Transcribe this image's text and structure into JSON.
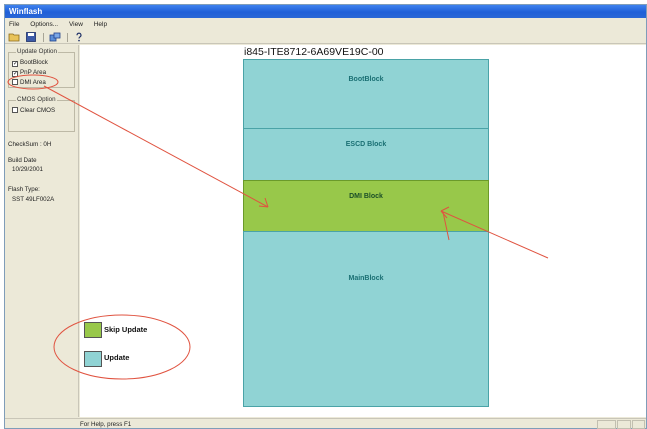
{
  "window": {
    "title": "Winflash"
  },
  "menu": [
    "File",
    "Options...",
    "View",
    "Help"
  ],
  "toolbar": [
    {
      "name": "open-icon",
      "glyph": "📂"
    },
    {
      "name": "save-icon",
      "glyph": "💾"
    },
    {
      "name": "flash-icon",
      "glyph": "⚙"
    },
    {
      "name": "help-icon",
      "glyph": "?"
    }
  ],
  "update_option": {
    "title": "Update Option",
    "items": [
      {
        "label": "BootBlock",
        "checked": true
      },
      {
        "label": "PnP Area",
        "checked": true
      },
      {
        "label": "DMI Area",
        "checked": false
      }
    ]
  },
  "cmos_option": {
    "title": "CMOS Option",
    "items": [
      {
        "label": "Clear CMOS",
        "checked": false
      }
    ]
  },
  "info": {
    "checksum": "CheckSum : 0H",
    "build_date_label": "Build Date",
    "build_date": "10/29/2001",
    "flash_type_label": "Flash Type:",
    "flash_type": "SST 49LF002A"
  },
  "chip": {
    "title": "i845-ITE8712-6A69VE19C-00",
    "blocks": [
      {
        "label": "BootBlock",
        "update": true
      },
      {
        "label": "ESCD Block",
        "update": true
      },
      {
        "label": "DMI Block",
        "update": false
      },
      {
        "label": "MainBlock",
        "update": true
      }
    ]
  },
  "legend": {
    "skip_label": "Skip Update",
    "update_label": "Update",
    "skip_color": "#98c84a",
    "update_color": "#90d3d4"
  },
  "annotation_color": "#e05340",
  "status": {
    "text": "For Help, press F1"
  }
}
